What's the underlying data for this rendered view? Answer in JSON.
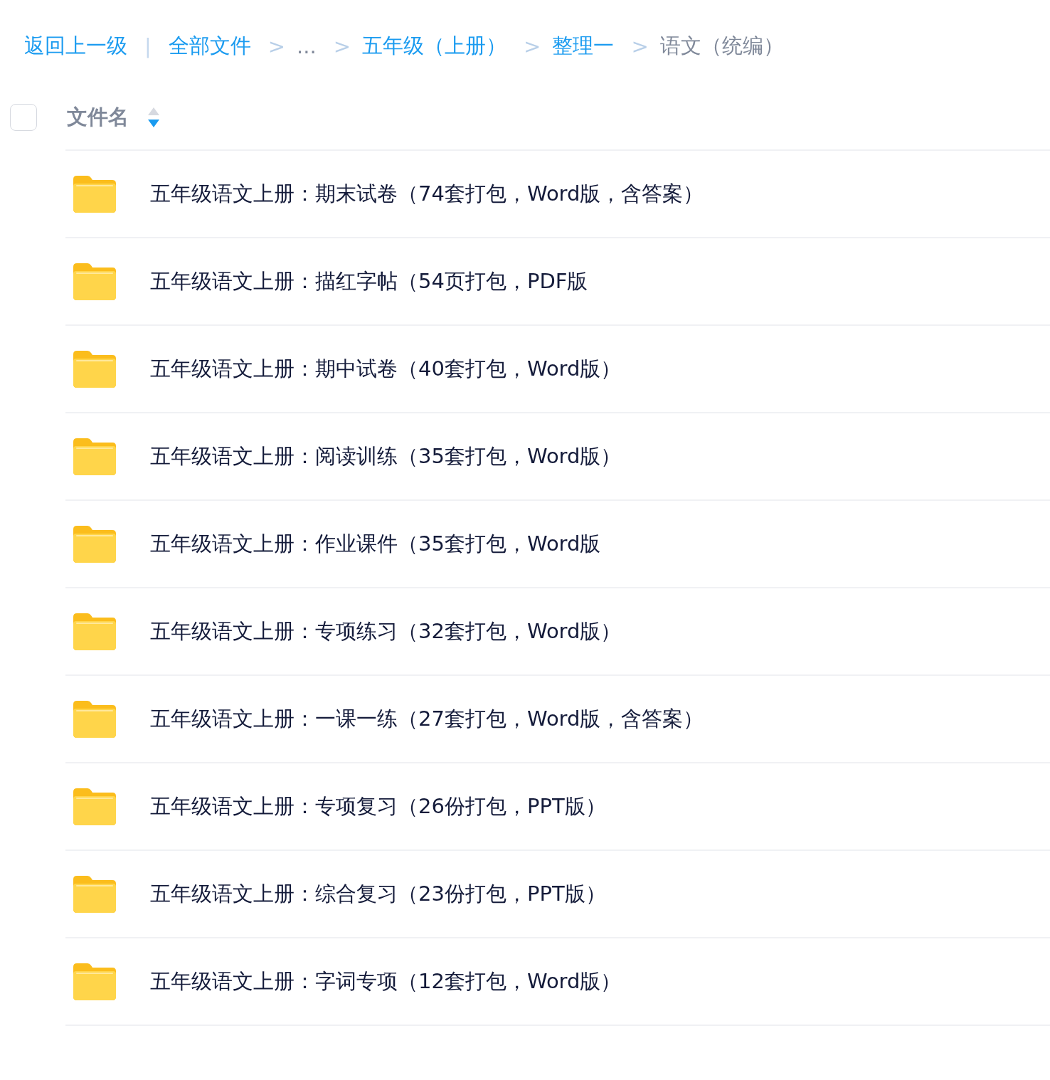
{
  "breadcrumb": {
    "back": "返回上一级",
    "divider": "|",
    "items": [
      {
        "label": "全部文件",
        "kind": "link"
      },
      {
        "separator": ">",
        "label": "...",
        "kind": "plain"
      },
      {
        "separator": ">",
        "label": "五年级（上册）",
        "kind": "link"
      },
      {
        "separator": ">",
        "label": "整理一",
        "kind": "link"
      },
      {
        "separator": ">",
        "label": "语文（统编）",
        "kind": "current"
      }
    ]
  },
  "header": {
    "checked": false,
    "label": "文件名",
    "sort_descending": true
  },
  "files": [
    {
      "kind": "folder",
      "name": "五年级语文上册：期末试卷（74套打包，Word版，含答案）"
    },
    {
      "kind": "folder",
      "name": "五年级语文上册：描红字帖（54页打包，PDF版"
    },
    {
      "kind": "folder",
      "name": "五年级语文上册：期中试卷（40套打包，Word版）"
    },
    {
      "kind": "folder",
      "name": "五年级语文上册：阅读训练（35套打包，Word版）"
    },
    {
      "kind": "folder",
      "name": "五年级语文上册：作业课件（35套打包，Word版"
    },
    {
      "kind": "folder",
      "name": "五年级语文上册：专项练习（32套打包，Word版）"
    },
    {
      "kind": "folder",
      "name": "五年级语文上册：一课一练（27套打包，Word版，含答案）"
    },
    {
      "kind": "folder",
      "name": "五年级语文上册：专项复习（26份打包，PPT版）"
    },
    {
      "kind": "folder",
      "name": "五年级语文上册：综合复习（23份打包，PPT版）"
    },
    {
      "kind": "folder",
      "name": "五年级语文上册：字词专项（12套打包，Word版）"
    }
  ]
}
